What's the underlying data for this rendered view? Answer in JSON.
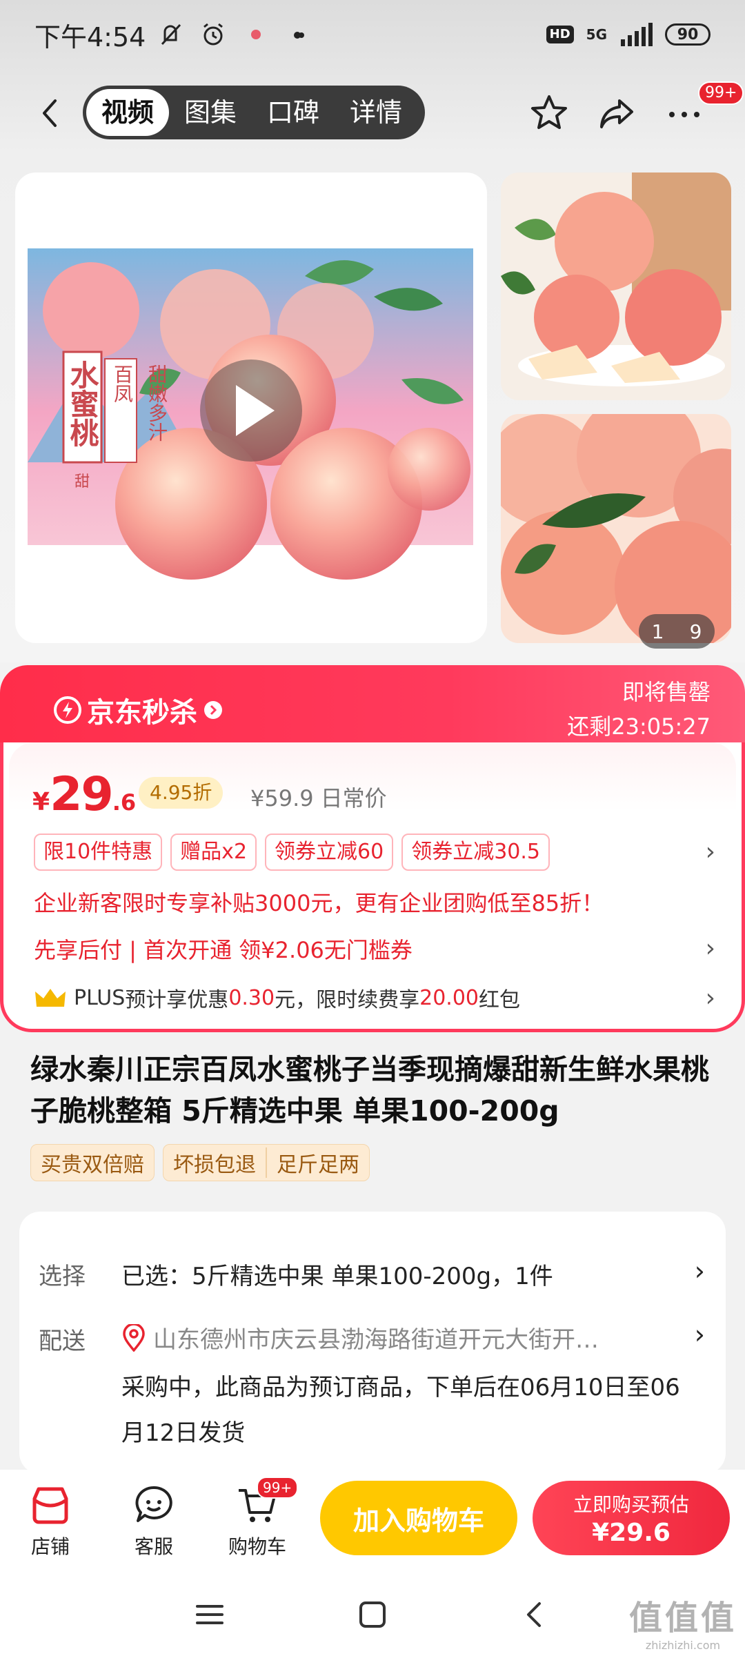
{
  "status_bar": {
    "time": "下午4:54",
    "network": "5G",
    "hd": "HD",
    "battery": "90"
  },
  "nav": {
    "tabs": [
      "视频",
      "图集",
      "口碑",
      "详情"
    ],
    "active_tab": "视频",
    "message_badge": "99+"
  },
  "gallery": {
    "poster_title": "水蜜桃",
    "poster_tag": "甜",
    "poster_line1": "百凤",
    "poster_line2": "甜嫩多汁",
    "current_page": "1",
    "total_pages": "9"
  },
  "seckill": {
    "logo": "京东秒杀",
    "status": "即将售罄",
    "timer": "还剩23:05:27"
  },
  "price": {
    "currency": "¥",
    "integer": "29",
    "decimal": ".6",
    "discount": "4.95折",
    "original": "¥59.9",
    "original_label": "日常价"
  },
  "promos": [
    "限10件特惠",
    "赠品x2",
    "领券立减60",
    "领券立减30.5"
  ],
  "enterprise_text": "企业新客限时专享补贴3000元，更有企业团购低至85折！",
  "pay_later_text": "先享后付 | 首次开通  领¥2.06无门槛券",
  "plus": {
    "label": "PLUS",
    "text1": "预计享优惠",
    "amount1": "0.30",
    "text2": "元，限时续费享",
    "amount2": "20.00",
    "text3": "红包"
  },
  "product_title": "绿水秦川正宗百凤水蜜桃子当季现摘爆甜新生鲜水果桃子脆桃整箱 5斤精选中果 单果100-200g",
  "services": [
    [
      "买贵双倍赔"
    ],
    [
      "坏损包退",
      "足斤足两"
    ]
  ],
  "spec": {
    "select_label": "选择",
    "select_value": "已选：5斤精选中果 单果100-200g，1件",
    "delivery_label": "配送",
    "address": "山东德州市庆云县渤海路街道开元大街开…",
    "note": "采购中，此商品为预订商品，下单后在06月10日至06月12日发货"
  },
  "action_bar": {
    "shop": "店铺",
    "service": "客服",
    "cart": "购物车",
    "cart_badge": "99+",
    "add_to_cart": "加入购物车",
    "buy_line1": "立即购买预估",
    "buy_line2": "¥29.6"
  },
  "watermark": {
    "big": "值值值",
    "small": "zhizhizhi.com"
  },
  "colors": {
    "accent_red": "#e8232f",
    "seckill_red": "#ff3a5c",
    "cart_yellow": "#ffc800"
  }
}
